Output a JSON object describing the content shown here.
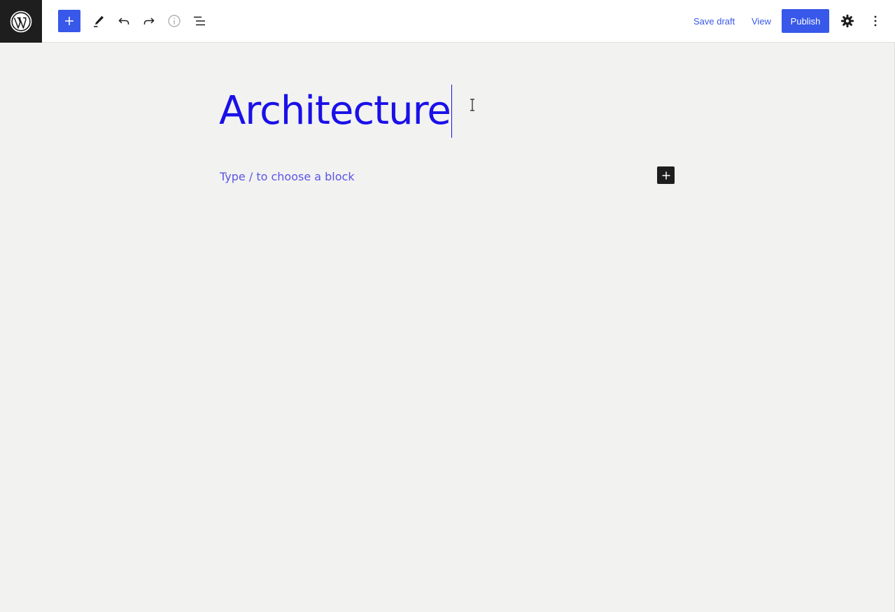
{
  "toolbar": {
    "icons": {
      "logo": "wordpress-logo",
      "inserter": "plus-icon",
      "tools": "pencil-icon",
      "undo": "undo-icon",
      "redo": "redo-icon",
      "details": "info-icon",
      "list_view": "list-view-icon",
      "settings": "gear-icon",
      "options": "kebab-icon"
    },
    "save_draft_label": "Save draft",
    "view_label": "View",
    "publish_label": "Publish"
  },
  "editor": {
    "title": "Architecture",
    "block_placeholder": "Type / to choose a block"
  },
  "colors": {
    "accent": "#3858e9",
    "title": "#1a10e8",
    "placeholder": "#5a55e6",
    "canvas": "#f2f2f1"
  }
}
